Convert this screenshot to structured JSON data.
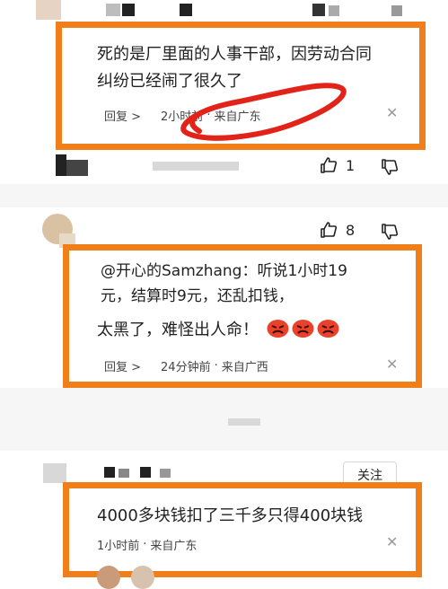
{
  "comment1": {
    "line1": "死的是厂里面的人事干部，因劳动合同",
    "line2": "纠纷已经闹了很久了",
    "reply_label": "回复 >",
    "time": "2小时前",
    "location": "来自广东",
    "like_count": "1"
  },
  "comment2": {
    "like_count": "8",
    "quote_line1": "@开心的Samzhang：听说1小时19",
    "quote_line2": "元，结算时9元，还乱扣钱，",
    "main_text": "太黑了，难怪出人命！",
    "reply_label": "回复 >",
    "time": "24分钟前",
    "location": "来自广西"
  },
  "comment3": {
    "follow_label": "关注",
    "text": "4000多块钱扣了三千多只得400块钱",
    "time": "1小时前",
    "location": "来自广东"
  },
  "separator": "·",
  "colors": {
    "highlight_border": "#f07f1a",
    "annotation_circle": "#e2231a"
  },
  "icons": [
    "thumbs-up-icon",
    "thumbs-down-icon",
    "close-icon",
    "angry-face-emoji"
  ]
}
